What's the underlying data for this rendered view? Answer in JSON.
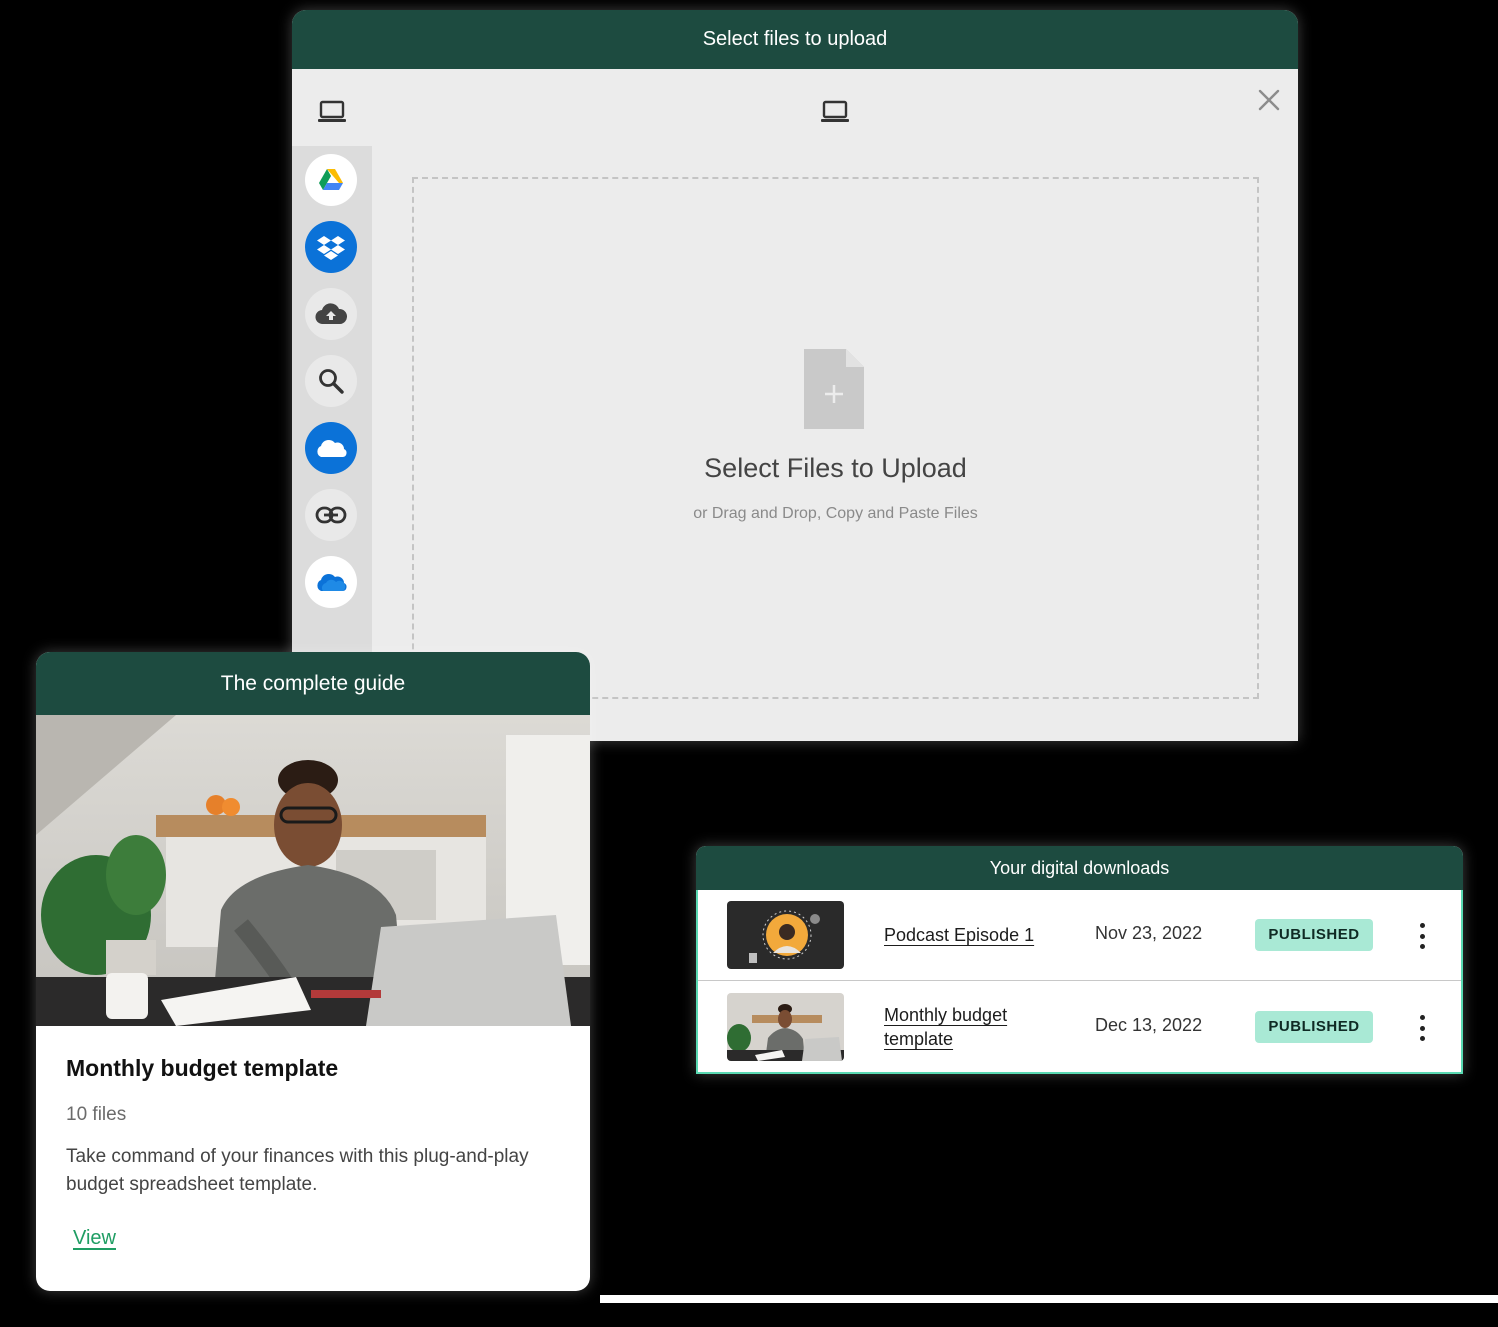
{
  "upload_modal": {
    "title": "Select files to upload",
    "dropzone_title": "Select Files to Upload",
    "dropzone_subtitle": "or Drag and Drop, Copy and Paste Files",
    "sources": [
      {
        "icon": "google-drive-icon"
      },
      {
        "icon": "dropbox-icon"
      },
      {
        "icon": "cloud-upload-icon"
      },
      {
        "icon": "search-icon"
      },
      {
        "icon": "onedrive-icon"
      },
      {
        "icon": "link-icon"
      },
      {
        "icon": "onedrive-business-icon"
      }
    ]
  },
  "guide_card": {
    "header": "The complete guide",
    "title": "Monthly budget template",
    "file_count": "10 files",
    "description": "Take command of your finances with this plug-and-play budget spreadsheet template.",
    "link": "View"
  },
  "downloads": {
    "header": "Your digital downloads",
    "rows": [
      {
        "title": "Podcast Episode 1",
        "date": "Nov 23, 2022",
        "status": "PUBLISHED"
      },
      {
        "title": "Monthly budget template",
        "date": "Dec 13, 2022",
        "status": "PUBLISHED"
      }
    ]
  },
  "colors": {
    "header_green": "#1d4b40",
    "link_green": "#1f9d63",
    "badge_mint": "#a9e9d5",
    "panel_border": "#59d9b2",
    "modal_bg": "#ececec"
  }
}
